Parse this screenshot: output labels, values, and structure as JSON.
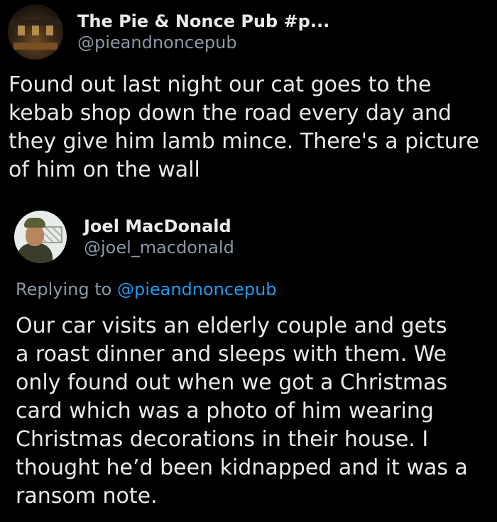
{
  "colors": {
    "background": "#000000",
    "text": "#e7e9ea",
    "secondary": "#8b98a5",
    "link": "#1d9bf0"
  },
  "tweet": {
    "display_name": "The Pie & Nonce Pub #p...",
    "handle": "@pieandnoncepub",
    "avatar_icon": "pub-interior-avatar",
    "lines": [
      "Found out last night our cat goes to the",
      "kebab shop down the road every day and",
      "they give him lamb mince. There's a picture",
      "of him on the wall"
    ]
  },
  "reply": {
    "display_name": "Joel MacDonald",
    "handle": "@joel_macdonald",
    "avatar_icon": "person-avatar",
    "replying_label": "Replying to",
    "replying_to": "@pieandnoncepub",
    "lines": [
      "Our car visits an elderly couple and gets",
      "a roast dinner and sleeps with them. We",
      "only found out when we got a Christmas",
      "card which was a photo of him wearing",
      "Christmas decorations in their house. I",
      "thought he’d been kidnapped and it was a",
      "ransom note."
    ]
  }
}
